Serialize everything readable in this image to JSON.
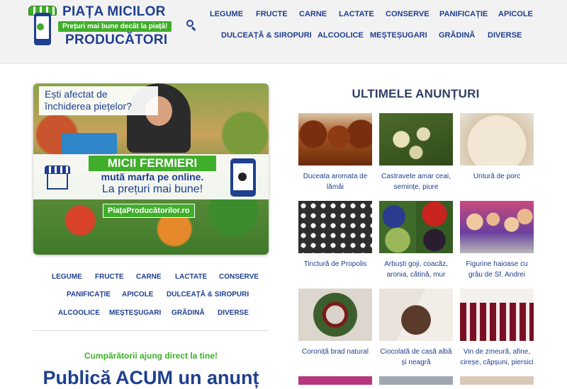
{
  "header": {
    "logo_line1": "PIAȚA MICILOR",
    "logo_tagline": "Prețuri mai bune decât la piață!",
    "logo_line2": "PRODUCĂTORI",
    "nav": [
      "LEGUME",
      "FRUCTE",
      "CARNE",
      "LACTATE",
      "CONSERVE",
      "PANIFICAȚIE",
      "APICOLE",
      "DULCEAȚĂ & SIROPURI",
      "ALCOOLICE",
      "MEȘTEȘUGARI",
      "GRĂDINĂ",
      "DIVERSE"
    ]
  },
  "banner": {
    "question": "Ești afectat de închiderea piețelor?",
    "brand": "MICII FERMIERI",
    "line2": "mută marfa pe online.",
    "line3": "La prețuri mai bune!",
    "url": "PiațaProducătorilor.ro"
  },
  "category_nav": [
    "LEGUME",
    "FRUCTE",
    "CARNE",
    "LACTATE",
    "CONSERVE",
    "PANIFICAȚIE",
    "APICOLE",
    "DULCEAȚĂ & SIROPURI",
    "ALCOOLICE",
    "MEȘTEȘUGARI",
    "GRĂDINĂ",
    "DIVERSE"
  ],
  "promo": "Cumpărătorii ajung direct la tine!",
  "publish": "Publică ACUM un anunț",
  "listings": {
    "title": "ULTIMELE ANUNȚURI",
    "items": [
      {
        "caption": "Duceata aromata de lămâi"
      },
      {
        "caption": "Castravete amar ceai, semințe, piure"
      },
      {
        "caption": "Untură de porc"
      },
      {
        "caption": "Tinctură de Propolis"
      },
      {
        "caption": "Arbuști goji, coacăz, aronia, cătină, mur"
      },
      {
        "caption": "Figurine haioase cu grâu de Sf. Andrei"
      },
      {
        "caption": "Coroniță brad natural"
      },
      {
        "caption": "Ciocolată de casă albă și neagră"
      },
      {
        "caption": "Vin de zmeură, afine, cireșe, căpșuni, piersici"
      }
    ]
  },
  "colors": {
    "brand_blue": "#1f3f8f",
    "brand_green": "#3fae2a",
    "header_bg": "#f2f2f2"
  }
}
